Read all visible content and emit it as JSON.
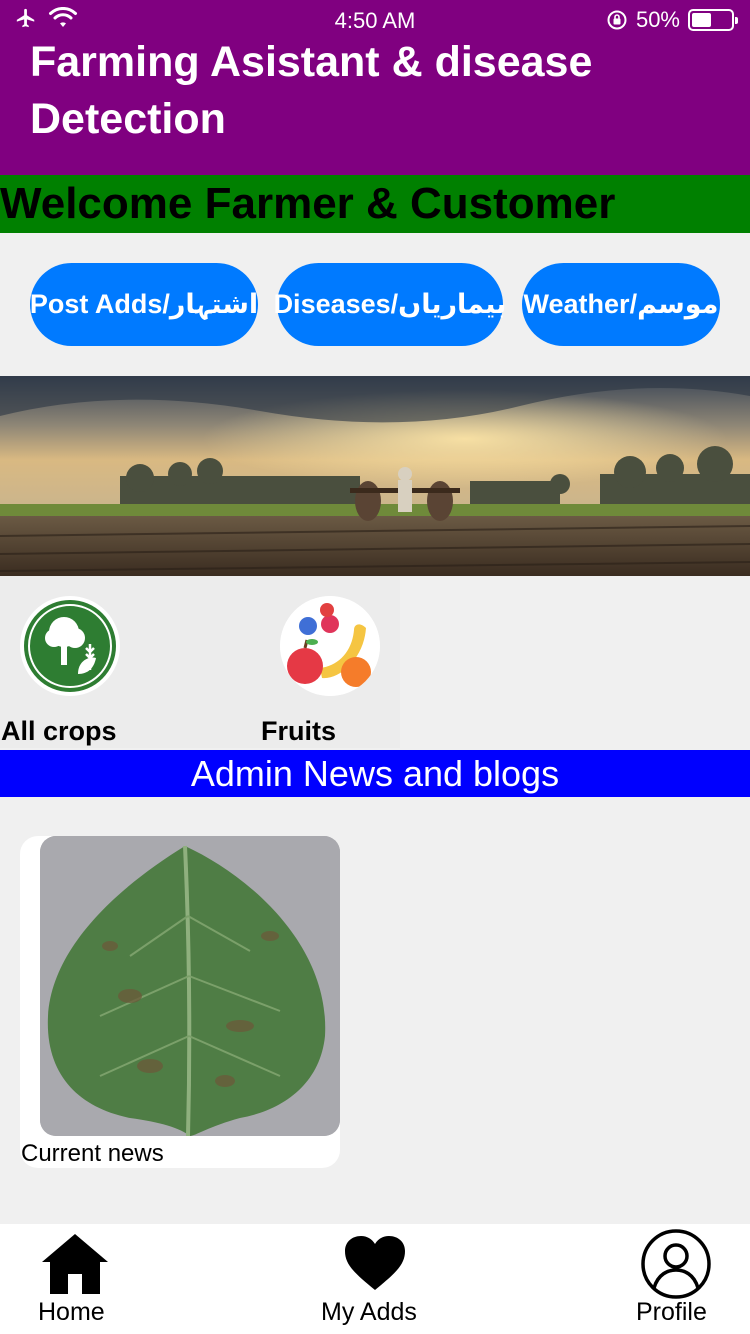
{
  "status": {
    "time": "4:50 AM",
    "battery": "50%",
    "battery_level": 0.5
  },
  "header": {
    "title": "Farming Asistant & disease Detection",
    "background": "#800080"
  },
  "welcome": {
    "text": "Welcome Farmer & Customer",
    "background": "#008000"
  },
  "actions": [
    {
      "label": "Post Adds/اشتہار"
    },
    {
      "label": "Diseases/بیماریاں"
    },
    {
      "label": "Weather/موسم"
    }
  ],
  "categories": [
    {
      "label": "All crops",
      "icon": "crops-tree-icon"
    },
    {
      "label": "Fruits",
      "icon": "fruits-icon"
    }
  ],
  "news": {
    "heading": "Admin News and blogs",
    "background": "#0000ff",
    "cards": [
      {
        "caption": "Current news",
        "image": "diseased-leaf-image"
      }
    ]
  },
  "tabs": [
    {
      "label": "Home",
      "icon": "home-icon"
    },
    {
      "label": "My Adds",
      "icon": "heart-icon"
    },
    {
      "label": "Profile",
      "icon": "user-icon"
    }
  ],
  "colors": {
    "accent": "#007aff",
    "page_bg": "#f0f0f0"
  }
}
